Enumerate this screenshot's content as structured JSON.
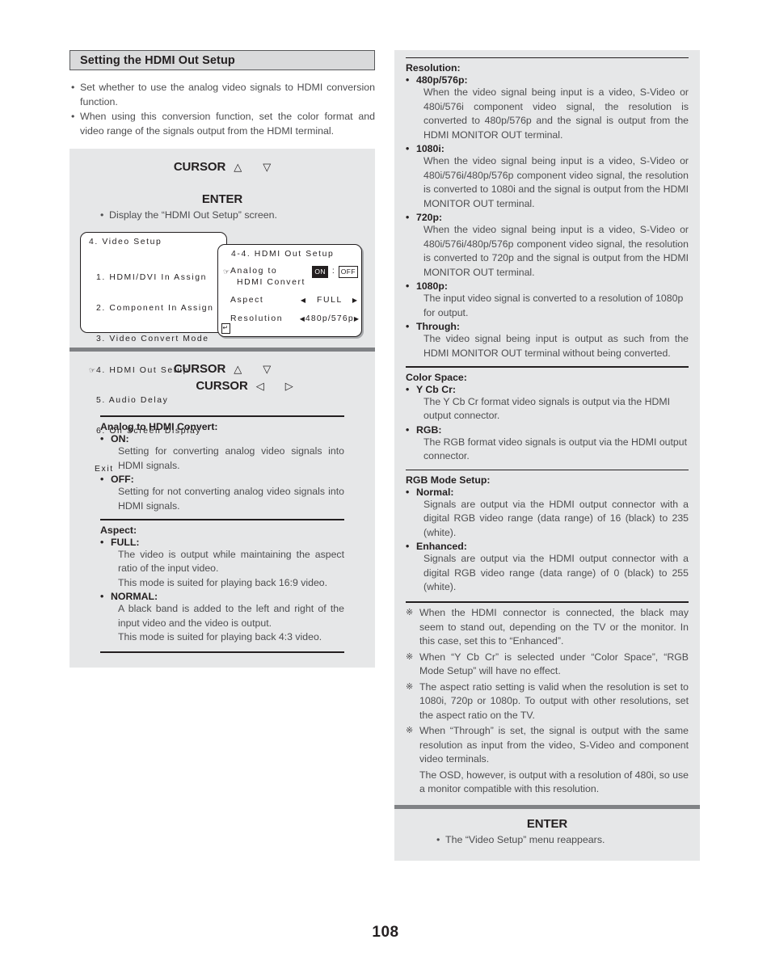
{
  "page": {
    "number": "108"
  },
  "left": {
    "section_title": "Setting the HDMI Out Setup",
    "intro_bullets": [
      "Set whether to use the analog video signals to HDMI conversion function.",
      "When using this conversion function, set the color format and video range of the signals output from the HDMI terminal."
    ],
    "keys_top": {
      "cursor_label": "CURSOR",
      "up_arrow": "△",
      "down_arrow": "▽",
      "enter_label": "ENTER",
      "enter_note": "Display the “HDMI Out Setup” screen."
    },
    "osd": {
      "back": {
        "title": "4. Video Setup",
        "items": [
          "1. HDMI/DVI In Assign",
          "2. Component In Assign",
          "3. Video Convert Mode",
          "4. HDMI Out Setup",
          "5. Audio Delay",
          "6. On Screen Display"
        ],
        "selected_index": 3,
        "cursor_mark": "☞",
        "exit": "Exit"
      },
      "front": {
        "title": "4-4. HDMI Out Setup",
        "cursor_mark": "☞",
        "row1_label_line1": "Analog to",
        "row1_label_line2": "HDMI Convert",
        "row1_on": "ON",
        "row1_separator": ":",
        "row1_off": "OFF",
        "row2_label": "Aspect",
        "row2_left_arrow": "◀",
        "row2_value": "FULL",
        "row2_right_arrow": "▶",
        "row3_label": "Resolution",
        "row3_left_arrow": "◀",
        "row3_value": "480p/576p",
        "row3_right_arrow": "▶",
        "enter_glyph": "↵"
      }
    },
    "keys_mid": {
      "cursor_label_1": "CURSOR",
      "up_arrow": "△",
      "down_arrow": "▽",
      "cursor_label_2": "CURSOR",
      "left_arrow": "◁",
      "right_arrow": "▷"
    },
    "defs": [
      {
        "head": "Analog to HDMI Convert:",
        "items": [
          {
            "label": "ON:",
            "text": "Setting for converting analog video signals into HDMI signals."
          },
          {
            "label": "OFF:",
            "text": "Setting for not converting analog video signals into HDMI signals."
          }
        ]
      },
      {
        "head": "Aspect:",
        "items": [
          {
            "label": "FULL:",
            "text": "The video is output while maintaining the aspect ratio of the input video.\nThis mode is suited for playing back 16:9 video."
          },
          {
            "label": "NORMAL:",
            "text": "A black band is added to the left and right of the input video and the video is output.\nThis mode is suited for playing back 4:3 video."
          }
        ]
      }
    ]
  },
  "right": {
    "defs": [
      {
        "head": "Resolution:",
        "items": [
          {
            "label": "480p/576p:",
            "text": "When the video signal being input is a video, S-Video or 480i/576i component video signal, the resolution is converted to 480p/576p and the signal is output from the HDMI MONITOR OUT terminal."
          },
          {
            "label": "1080i:",
            "text": "When the video signal being input is a video, S-Video or 480i/576i/480p/576p component video signal, the resolution is converted to 1080i and the signal is output from the HDMI MONITOR OUT terminal."
          },
          {
            "label": "720p:",
            "text": "When the video signal being input is a video, S-Video or 480i/576i/480p/576p component video signal, the resolution is converted to 720p and the signal is output from the HDMI MONITOR OUT terminal."
          },
          {
            "label": "1080p:",
            "text": "The input video signal is converted to a resolution of 1080p for output."
          },
          {
            "label": "Through:",
            "text": "The video signal being input is output as such from the HDMI MONITOR OUT terminal without being converted."
          }
        ]
      },
      {
        "head": "Color Space:",
        "items": [
          {
            "label": "Y Cb Cr:",
            "text": "The Y Cb Cr format video signals is output via the HDMI output connector."
          },
          {
            "label": "RGB:",
            "text": "The RGB format video signals is output via the HDMI output connector."
          }
        ]
      },
      {
        "head": "RGB Mode Setup:",
        "items": [
          {
            "label": "Normal:",
            "text": "Signals are output via the HDMI output connector with a digital RGB video range (data range) of 16 (black) to 235 (white)."
          },
          {
            "label": "Enhanced:",
            "text": "Signals are output via the HDMI output connector with a digital RGB video range (data range) of 0 (black) to 255 (white)."
          }
        ]
      }
    ],
    "notes_mark": "※",
    "notes": [
      "When the HDMI connector is connected, the black may seem to stand out, depending on the TV or the monitor. In this case, set this to “Enhanced”.",
      "When “Y Cb Cr” is selected under “Color Space”, “RGB Mode Setup” will have no effect.",
      "The aspect ratio setting is valid when the resolution is set to 1080i, 720p or 1080p. To output with other resolutions, set the aspect ratio on the TV.",
      "When “Through” is set, the signal is output with the same resolution as input from the video, S-Video and component video terminals."
    ],
    "notes_tail": "The OSD, however, is output with a resolution of 480i, so use a monitor compatible with this resolution.",
    "enter": {
      "label": "ENTER",
      "note": "The “Video Setup” menu reappears."
    }
  },
  "colors": {
    "panel_gray": "#e6e7e8",
    "title_gray": "#d9dadb",
    "bar_gray": "#808285",
    "text_dark": "#231f20",
    "text_body": "#4d4d4f"
  }
}
